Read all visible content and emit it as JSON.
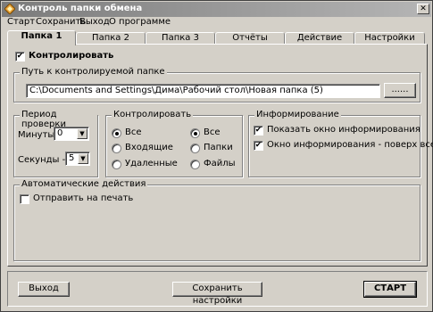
{
  "window": {
    "title": "Контроль папки обмена",
    "close_label": "✕"
  },
  "menu": [
    "Старт",
    "Сохранить",
    "Выход",
    "О программе"
  ],
  "tabs": [
    "Папка 1",
    "Папка 2",
    "Папка 3",
    "Отчёты",
    "Действие",
    "Настройки"
  ],
  "active_tab": "Папка 1",
  "controlled": {
    "label": "Контролировать",
    "checked": true
  },
  "path_group": {
    "label": "Путь к контролируемой папке",
    "value": "C:\\Documents and Settings\\Дима\\Рабочий стол\\Новая папка (5)",
    "browse_label": "......"
  },
  "period_group": {
    "label": "Период проверки",
    "minutes_label": "Минуты -",
    "minutes_value": "0",
    "seconds_label": "Секунды -",
    "seconds_value": "5"
  },
  "control_group": {
    "label": "Контролировать",
    "left": [
      {
        "label": "Все",
        "selected": true
      },
      {
        "label": "Входящие",
        "selected": false
      },
      {
        "label": "Удаленные",
        "selected": false
      }
    ],
    "right": [
      {
        "label": "Все",
        "selected": true
      },
      {
        "label": "Папки",
        "selected": false
      },
      {
        "label": "Файлы",
        "selected": false
      }
    ]
  },
  "inform_group": {
    "label": "Информирование",
    "show_window": {
      "label": "Показать окно информирования",
      "checked": true
    },
    "on_top": {
      "label": "Окно информирования - поверх всех",
      "checked": true
    }
  },
  "auto_group": {
    "label": "Автоматические действия",
    "print": {
      "label": "Отправить на печать",
      "checked": false
    }
  },
  "buttons": {
    "exit": "Выход",
    "save": "Сохранить настройки",
    "start": "СТАРТ"
  },
  "check_mark": "✔",
  "dropdown_arrow": "▼",
  "icons": [
    "app-diamond-icon",
    "close-icon",
    "check-icon",
    "chevron-down-icon"
  ],
  "colors": {
    "face": "#d4d0c8",
    "title_start": "#7b7b7b",
    "title_end": "#b5b5b5",
    "app_icon": "#e8a23a"
  }
}
